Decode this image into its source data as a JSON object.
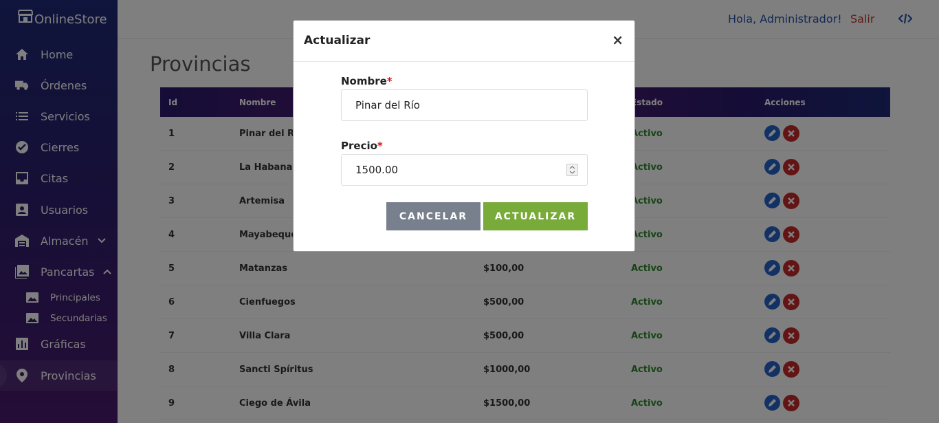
{
  "brand": "OnlineStore",
  "nav": [
    {
      "label": "Home",
      "icon": "home-icon"
    },
    {
      "label": "Órdenes",
      "icon": "truck-icon"
    },
    {
      "label": "Servicios",
      "icon": "list-icon"
    },
    {
      "label": "Cierres",
      "icon": "badge-check-icon"
    },
    {
      "label": "Citas",
      "icon": "inbox-icon"
    },
    {
      "label": "Usuarios",
      "icon": "user-card-icon"
    },
    {
      "label": "Almacén",
      "icon": "warehouse-icon"
    },
    {
      "label": "Pancartas",
      "icon": "image-icon"
    },
    {
      "label": "Gráficas",
      "icon": "chart-icon"
    },
    {
      "label": "Provincias",
      "icon": "map-pin-icon"
    }
  ],
  "nav_sub": [
    {
      "label": "Principales",
      "icon": "image-icon"
    },
    {
      "label": "Secundarias",
      "icon": "image-icon"
    }
  ],
  "topbar": {
    "greeting": "Hola, Administrador!",
    "logout": "Salir"
  },
  "page_title": "Provincias",
  "table": {
    "headers": {
      "id": "Id",
      "name": "Nombre",
      "state": "Estado",
      "actions": "Acciones"
    },
    "rows": [
      {
        "id": "1",
        "name": "Pinar del Río",
        "price": "",
        "state": "Activo"
      },
      {
        "id": "2",
        "name": "La Habana",
        "price": "",
        "state": "Activo"
      },
      {
        "id": "3",
        "name": "Artemisa",
        "price": "",
        "state": "Activo"
      },
      {
        "id": "4",
        "name": "Mayabeque",
        "price": "",
        "state": "Activo"
      },
      {
        "id": "5",
        "name": "Matanzas",
        "price": "$100,00",
        "state": "Activo"
      },
      {
        "id": "6",
        "name": "Cienfuegos",
        "price": "$500,00",
        "state": "Activo"
      },
      {
        "id": "7",
        "name": "Villa Clara",
        "price": "$500,00",
        "state": "Activo"
      },
      {
        "id": "8",
        "name": "Sancti Spíritus",
        "price": "$1000,00",
        "state": "Activo"
      },
      {
        "id": "9",
        "name": "Ciego de Ávila",
        "price": "$1500,00",
        "state": "Activo"
      }
    ]
  },
  "modal": {
    "title": "Actualizar",
    "close": "×",
    "name_label": "Nombre",
    "name_value": "Pinar del Río",
    "price_label": "Precio",
    "price_value": "1500.00",
    "required_mark": "*",
    "cancel": "CANCELAR",
    "submit": "ACTUALIZAR"
  },
  "colors": {
    "sidebar": "#2d1f6e",
    "link": "#2255aa",
    "danger": "#c62828",
    "success": "#79ab3a",
    "edit": "#2563c9"
  }
}
